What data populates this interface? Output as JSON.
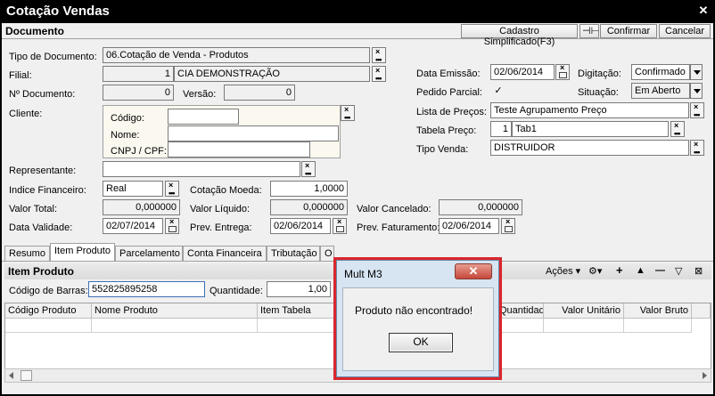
{
  "window": {
    "title": "Cotação Vendas",
    "close": "✕"
  },
  "header": {
    "title": "Documento",
    "cadastro_label": "Cadastro Simplificado(F3)",
    "pin_label": "⊣⊢",
    "confirmar_label": "Confirmar",
    "cancelar_label": "Cancelar"
  },
  "form": {
    "tipo_documento": {
      "label": "Tipo de Documento:",
      "value": "06.Cotação de Venda - Produtos"
    },
    "filial": {
      "label": "Filial:",
      "code": "1",
      "name": "CIA DEMONSTRAÇÃO"
    },
    "n_documento": {
      "label": "Nº Documento:",
      "value": "0"
    },
    "versao": {
      "label": "Versão:",
      "value": "0"
    },
    "cliente": {
      "label": "Cliente:",
      "codigo_label": "Código:",
      "codigo_value": "",
      "nome_label": "Nome:",
      "nome_value": "",
      "cnpj_label": "CNPJ / CPF:",
      "cnpj_value": ""
    },
    "representante": {
      "label": "Representante:",
      "value": ""
    },
    "indice_financeiro": {
      "label": "Indice Financeiro:",
      "value": "Real"
    },
    "cotacao_moeda": {
      "label": "Cotação Moeda:",
      "value": "1,0000"
    },
    "valor_total": {
      "label": "Valor Total:",
      "value": "0,000000"
    },
    "valor_liquido": {
      "label": "Valor Líquido:",
      "value": "0,000000"
    },
    "valor_cancelado": {
      "label": "Valor Cancelado:",
      "value": "0,000000"
    },
    "data_validade": {
      "label": "Data Validade:",
      "value": "02/07/2014"
    },
    "prev_entrega": {
      "label": "Prev. Entrega:",
      "value": "02/06/2014"
    },
    "prev_faturamento": {
      "label": "Prev. Faturamento:",
      "value": "02/06/2014"
    },
    "data_emissao": {
      "label": "Data Emissão:",
      "value": "02/06/2014"
    },
    "digitacao": {
      "label": "Digitação:",
      "value": "Confirmado"
    },
    "pedido_parcial": {
      "label": "Pedido Parcial:",
      "checked": "✓"
    },
    "situacao": {
      "label": "Situação:",
      "value": "Em Aberto"
    },
    "lista_precos": {
      "label": "Lista de Preços:",
      "value": "Teste Agrupamento Preço"
    },
    "tabela_preco": {
      "label": "Tabela Preço:",
      "code": "1",
      "name": "Tab1"
    },
    "tipo_venda": {
      "label": "Tipo Venda:",
      "value": "DISTRUIDOR"
    }
  },
  "tabs": [
    {
      "label": "Resumo"
    },
    {
      "label": "Item Produto"
    },
    {
      "label": "Parcelamento"
    },
    {
      "label": "Conta Financeira"
    },
    {
      "label": "Tributação"
    },
    {
      "label": "O"
    }
  ],
  "item_produto": {
    "title": "Item Produto",
    "acoes_label": "Ações ▾",
    "codigo_barras_label": "Código de Barras:",
    "codigo_barras_value": "552825895258",
    "quantidade_label": "Quantidade:",
    "quantidade_value": "1,00",
    "columns": [
      "Código Produto",
      "Nome Produto",
      "Item Tabela",
      "Quantidade",
      "Valor Unitário",
      "Valor Bruto"
    ]
  },
  "dialog": {
    "title": "Mult M3",
    "close": "✕",
    "message": "Produto não encontrado!",
    "ok_label": "OK"
  },
  "icons": {
    "lookup": "search-lookup-icon",
    "calendar": "calendar-icon"
  },
  "colors": {
    "title_bar": "#000000",
    "dialog_highlight": "#d9262d",
    "dialog_close": "#c5473a"
  }
}
